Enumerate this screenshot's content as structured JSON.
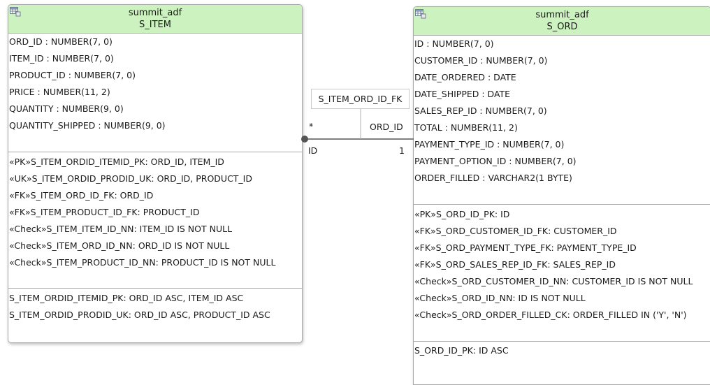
{
  "item_table": {
    "schema": "summit_adf",
    "name": "S_ITEM",
    "columns": [
      "ORD_ID : NUMBER(7, 0)",
      "ITEM_ID : NUMBER(7, 0)",
      "PRODUCT_ID : NUMBER(7, 0)",
      "PRICE : NUMBER(11, 2)",
      "QUANTITY : NUMBER(9, 0)",
      "QUANTITY_SHIPPED : NUMBER(9, 0)"
    ],
    "constraints": [
      "«PK»S_ITEM_ORDID_ITEMID_PK: ORD_ID, ITEM_ID",
      "«UK»S_ITEM_ORDID_PRODID_UK: ORD_ID, PRODUCT_ID",
      "«FK»S_ITEM_ORD_ID_FK: ORD_ID",
      "«FK»S_ITEM_PRODUCT_ID_FK: PRODUCT_ID",
      "«Check»S_ITEM_ITEM_ID_NN: ITEM_ID IS NOT NULL",
      "«Check»S_ITEM_ORD_ID_NN: ORD_ID IS NOT NULL",
      "«Check»S_ITEM_PRODUCT_ID_NN: PRODUCT_ID IS NOT NULL"
    ],
    "indexes": [
      "S_ITEM_ORDID_ITEMID_PK: ORD_ID ASC, ITEM_ID ASC",
      "S_ITEM_ORDID_PRODID_UK: ORD_ID ASC, PRODUCT_ID ASC"
    ]
  },
  "ord_table": {
    "schema": "summit_adf",
    "name": "S_ORD",
    "columns": [
      "ID : NUMBER(7, 0)",
      "CUSTOMER_ID : NUMBER(7, 0)",
      "DATE_ORDERED : DATE",
      "DATE_SHIPPED : DATE",
      "SALES_REP_ID : NUMBER(7, 0)",
      "TOTAL : NUMBER(11, 2)",
      "PAYMENT_TYPE_ID : NUMBER(7, 0)",
      "PAYMENT_OPTION_ID : NUMBER(7, 0)",
      "ORDER_FILLED : VARCHAR2(1 BYTE)"
    ],
    "constraints": [
      "«PK»S_ORD_ID_PK: ID",
      "«FK»S_ORD_CUSTOMER_ID_FK: CUSTOMER_ID",
      "«FK»S_ORD_PAYMENT_TYPE_FK: PAYMENT_TYPE_ID",
      "«FK»S_ORD_SALES_REP_ID_FK: SALES_REP_ID",
      "«Check»S_ORD_CUSTOMER_ID_NN: CUSTOMER_ID IS NOT NULL",
      "«Check»S_ORD_ID_NN: ID IS NOT NULL",
      "«Check»S_ORD_ORDER_FILLED_CK: ORDER_FILLED IN ('Y', 'N')"
    ],
    "indexes": [
      "S_ORD_ID_PK: ID ASC"
    ]
  },
  "relationship": {
    "name": "S_ITEM_ORD_ID_FK",
    "source_multiplicity": "*",
    "source_column": "ID",
    "target_column": "ORD_ID",
    "target_multiplicity": "1"
  },
  "icons": {
    "table": "table-icon"
  },
  "colors": {
    "header_fill": "#ccf2bf",
    "border": "#a9a9a9",
    "connector": "#555555"
  }
}
